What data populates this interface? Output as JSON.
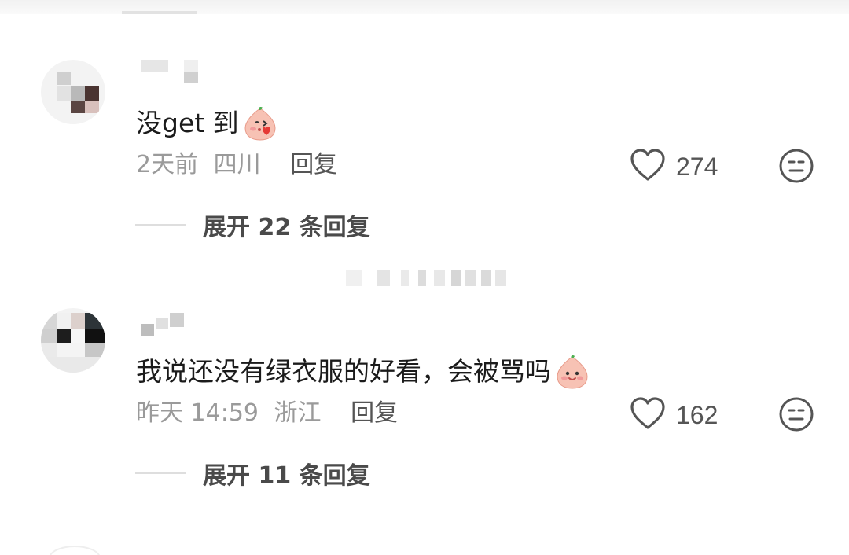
{
  "comments": [
    {
      "text": "没get 到",
      "emoji": "blowing-kiss-peach-emoji",
      "time": "2天前",
      "location": "四川",
      "reply_label": "回复",
      "likes": "274",
      "expand_label": "展开 22 条回复"
    },
    {
      "text": "我说还没有绿衣服的好看，会被骂吗",
      "emoji": "smiling-peach-emoji",
      "time": "昨天 14:59",
      "location": "浙江",
      "reply_label": "回复",
      "likes": "162",
      "expand_label": "展开 11 条回复"
    }
  ],
  "icons": {
    "like": "heart-outline-icon",
    "dislike": "neutral-face-icon"
  },
  "colors": {
    "text_primary": "#1b1b1b",
    "text_meta": "#9a9a9a",
    "text_action": "#555555",
    "peach": "#f7b8a8"
  }
}
